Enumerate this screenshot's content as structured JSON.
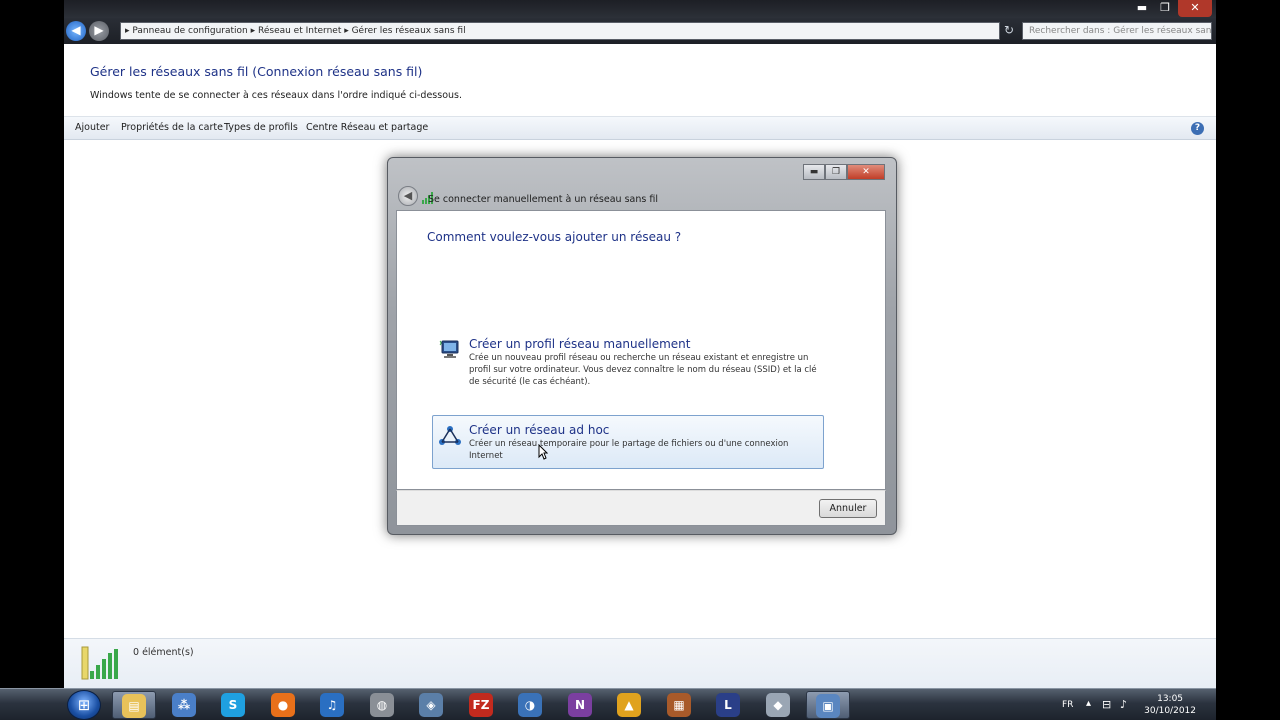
{
  "window": {
    "minimize_glyph": "▬",
    "maximize_glyph": "❐",
    "close_glyph": "✕"
  },
  "address_bar": {
    "path": "▸ Panneau de configuration ▸ Réseau et Internet ▸ Gérer les réseaux sans fil",
    "refresh_glyph": "↻",
    "search_placeholder": "Rechercher dans : Gérer les réseaux sans fil"
  },
  "header": {
    "title": "Gérer les réseaux sans fil (Connexion réseau sans fil)",
    "description": "Windows tente de se connecter à ces réseaux dans l'ordre indiqué ci-dessous."
  },
  "command_bar": {
    "items": [
      "Ajouter",
      "Propriétés de la carte",
      "Types de profils",
      "Centre Réseau et partage"
    ],
    "help_glyph": "?"
  },
  "details_pane": {
    "count": "0 élément(s)"
  },
  "dialog": {
    "caption": "Se connecter manuellement à un réseau sans fil",
    "question": "Comment voulez-vous ajouter un réseau ?",
    "back_glyph": "◀",
    "options": [
      {
        "title": "Créer un profil réseau manuellement",
        "description": "Crée un nouveau profil réseau ou recherche un réseau existant et enregistre un profil sur votre ordinateur. Vous devez connaître le nom du réseau (SSID) et la clé de sécurité (le cas échéant).",
        "icon": "monitor-network-icon"
      },
      {
        "title": "Créer un réseau ad hoc",
        "description": "Créer un réseau temporaire pour le partage de fichiers ou d'une connexion Internet",
        "icon": "adhoc-network-icon"
      }
    ],
    "cancel_label": "Annuler"
  },
  "taskbar": {
    "start_glyph": "⊞",
    "apps": [
      {
        "name": "explorer",
        "glyph": "▤",
        "color": "#e8c25a",
        "active": true
      },
      {
        "name": "network",
        "glyph": "⁂",
        "color": "#4a7fc8",
        "active": false
      },
      {
        "name": "skype",
        "glyph": "S",
        "color": "#1fa0e0",
        "active": false
      },
      {
        "name": "firefox",
        "glyph": "●",
        "color": "#e8701a",
        "active": false
      },
      {
        "name": "itunes",
        "glyph": "♫",
        "color": "#2a6fc2",
        "active": false
      },
      {
        "name": "app-6",
        "glyph": "◍",
        "color": "#8a8f96",
        "active": false
      },
      {
        "name": "app-7",
        "glyph": "◈",
        "color": "#5b7fa8",
        "active": false
      },
      {
        "name": "filezilla",
        "glyph": "FZ",
        "color": "#c22a1e",
        "active": false
      },
      {
        "name": "app-9",
        "glyph": "◑",
        "color": "#3a72b8",
        "active": false
      },
      {
        "name": "app-10",
        "glyph": "N",
        "color": "#7b3fa0",
        "active": false
      },
      {
        "name": "app-11",
        "glyph": "▲",
        "color": "#e0a21e",
        "active": false
      },
      {
        "name": "app-12",
        "glyph": "▦",
        "color": "#a85a2a",
        "active": false
      },
      {
        "name": "app-13",
        "glyph": "L",
        "color": "#2a3f88",
        "active": false
      },
      {
        "name": "app-14",
        "glyph": "◆",
        "color": "#9aa6b4",
        "active": false
      },
      {
        "name": "app-15",
        "glyph": "▣",
        "color": "#5a86c0",
        "active": true
      }
    ],
    "language": "FR",
    "time": "13:05",
    "date": "30/10/2012"
  }
}
